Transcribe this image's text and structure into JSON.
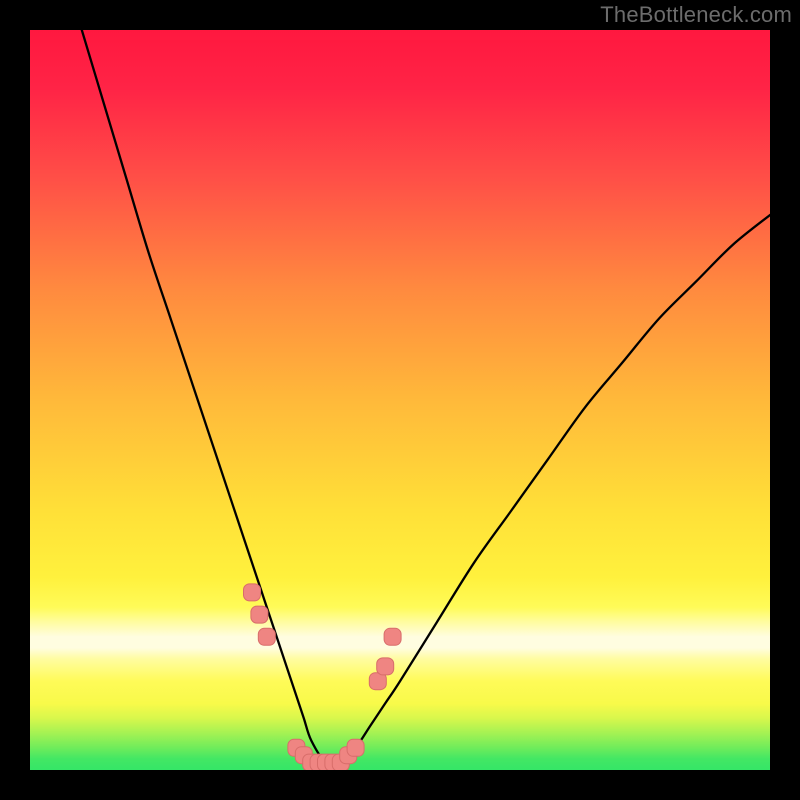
{
  "watermark": "TheBottleneck.com",
  "colors": {
    "frame": "#000000",
    "curve": "#000000",
    "marker_fill": "#ef8582",
    "marker_stroke": "#d86d6a",
    "greenBand": "#37e666",
    "yellowBand": "#fff59a"
  },
  "chart_data": {
    "type": "line",
    "title": "",
    "xlabel": "",
    "ylabel": "",
    "xlim": [
      0,
      100
    ],
    "ylim": [
      0,
      100
    ],
    "grid": false,
    "legend": false,
    "series": [
      {
        "name": "bottleneck-curve",
        "x": [
          7,
          10,
          13,
          16,
          19,
          22,
          24,
          26,
          28,
          30,
          32,
          34,
          36,
          37,
          38,
          40,
          42,
          44,
          46,
          48,
          50,
          55,
          60,
          65,
          70,
          75,
          80,
          85,
          90,
          95,
          100
        ],
        "values": [
          100,
          90,
          80,
          70,
          61,
          52,
          46,
          40,
          34,
          28,
          22,
          16,
          10,
          7,
          4,
          1,
          1,
          3,
          6,
          9,
          12,
          20,
          28,
          35,
          42,
          49,
          55,
          61,
          66,
          71,
          75
        ]
      }
    ],
    "markers": [
      {
        "x": 30,
        "y": 24
      },
      {
        "x": 31,
        "y": 21
      },
      {
        "x": 32,
        "y": 18
      },
      {
        "x": 36,
        "y": 3
      },
      {
        "x": 37,
        "y": 2
      },
      {
        "x": 38,
        "y": 1
      },
      {
        "x": 39,
        "y": 1
      },
      {
        "x": 40,
        "y": 1
      },
      {
        "x": 41,
        "y": 1
      },
      {
        "x": 42,
        "y": 1
      },
      {
        "x": 43,
        "y": 2
      },
      {
        "x": 44,
        "y": 3
      },
      {
        "x": 47,
        "y": 12
      },
      {
        "x": 48,
        "y": 14
      },
      {
        "x": 49,
        "y": 18
      }
    ],
    "annotations": []
  }
}
